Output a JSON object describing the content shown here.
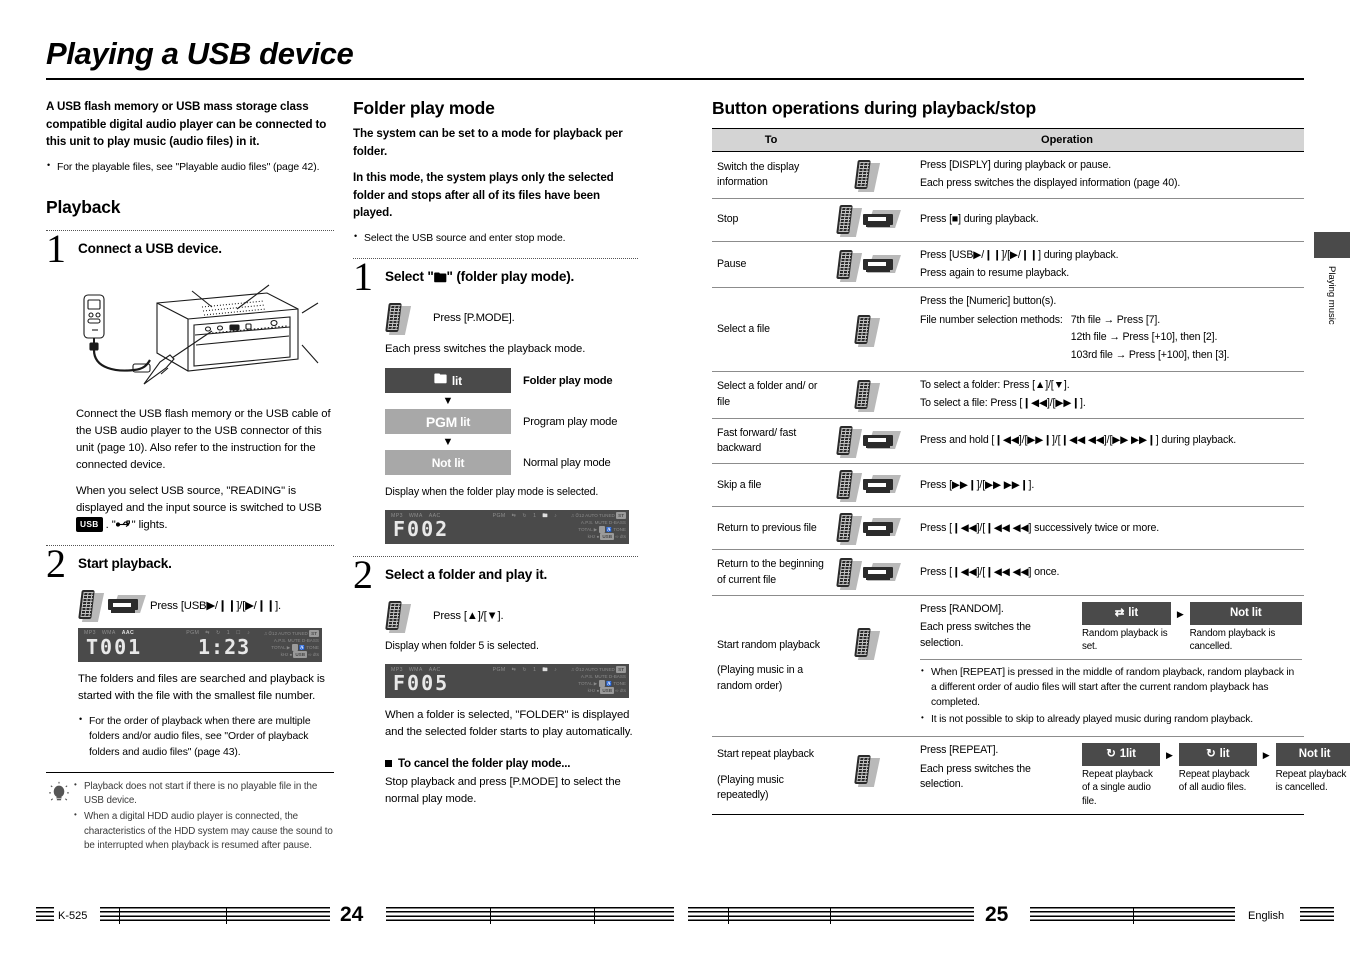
{
  "document": {
    "title": "Playing a USB device",
    "model": "K-525",
    "language": "English",
    "page_left": "24",
    "page_right": "25",
    "side_tab": "Playing music"
  },
  "intro": {
    "lead": "A USB flash memory or USB mass storage class compatible digital audio player can be connected to this unit to play music (audio files) in it.",
    "bullets": [
      "For the playable files, see \"Playable audio files\" (page 42)."
    ]
  },
  "playback": {
    "heading": "Playback",
    "step1": {
      "number": "1",
      "head": "Connect a USB device.",
      "para1": "Connect the USB flash memory or the USB cable of the USB audio player to the USB connector of this unit (page 10). Also refer to the instruction for the connected device.",
      "para2_a": "When you select USB source, \"READING\" is displayed and the input source is switched to USB",
      "usb_badge": "USB",
      "para2_b": "\" lights."
    },
    "step2": {
      "number": "2",
      "head": "Start playback.",
      "press": "Press [USB▶/❙❙]/[▶/❙❙].",
      "lcd": {
        "main": "T001",
        "time": "1:23",
        "indicators": [
          "MP3",
          "WMA",
          "AAC",
          "PGM"
        ],
        "highlight": "AAC"
      },
      "para": "The folders and files are searched and playback is started with the file with the smallest file number.",
      "bullets": [
        "For the order of playback when there are multiple folders and/or audio files, see  \"Order of playback folders and audio files\" (page 43)."
      ]
    },
    "tips": [
      "Playback does not start if there is no playable file in the USB device.",
      "When a digital HDD audio player is connected, the characteristics of the HDD system may cause the sound to be interrupted when playback is resumed after pause."
    ]
  },
  "folder_play": {
    "heading": "Folder play mode",
    "lead1": "The system can be set to a mode for playback per folder.",
    "lead2": "In this mode, the system plays only the selected folder and stops after all of its files have been played.",
    "bullets": [
      "Select the USB source and enter stop mode."
    ],
    "step1": {
      "number": "1",
      "head_a": "Select \"",
      "head_b": "\" (folder play mode).",
      "press": "Press [P.MODE].",
      "note": "Each press switches the playback mode.",
      "modes": [
        {
          "box": "lit",
          "icon": "folder",
          "label": "Folder play mode",
          "style": "dark",
          "bold": true
        },
        {
          "box": "lit",
          "icon": "pgm",
          "label": "Program play mode",
          "style": "mid",
          "bold": false
        },
        {
          "box": "Not lit",
          "icon": "",
          "label": "Normal play mode",
          "style": "mid",
          "bold": false
        }
      ],
      "caption": "Display when the folder play mode is selected.",
      "lcd": {
        "main": "F002"
      }
    },
    "step2": {
      "number": "2",
      "head": "Select a folder and play it.",
      "press": "Press [▲]/[▼].",
      "caption": "Display when folder 5 is selected.",
      "lcd": {
        "main": "F005"
      },
      "para": "When a folder is selected, \"FOLDER\" is displayed and the selected folder starts to play automatically."
    },
    "cancel": {
      "head": "To cancel the folder play mode...",
      "body": "Stop playback and press [P.MODE] to select the normal play mode."
    }
  },
  "operations": {
    "heading": "Button operations during playback/stop",
    "columns": {
      "to": "To",
      "operation": "Operation"
    },
    "rows": [
      {
        "to": "Switch the display information",
        "icons": [
          "remote"
        ],
        "lines": [
          "Press [DISPLY] during playback or pause.",
          "Each press switches the displayed information (page 40)."
        ]
      },
      {
        "to": "Stop",
        "icons": [
          "remote",
          "unit"
        ],
        "lines": [
          "Press [■] during playback."
        ]
      },
      {
        "to": "Pause",
        "icons": [
          "remote",
          "unit"
        ],
        "lines": [
          "Press [USB▶/❙❙]/[▶/❙❙] during playback.",
          "Press again to resume playback."
        ]
      },
      {
        "to": "Select a file",
        "icons": [
          "remote"
        ],
        "lines": [
          "Press the [Numeric] button(s)."
        ],
        "methods_label": "File number selection methods:",
        "methods": [
          "7th file → Press [7].",
          "12th file → Press [+10], then [2].",
          "103rd file → Press [+100], then [3]."
        ]
      },
      {
        "to": "Select a folder and/ or file",
        "icons": [
          "remote"
        ],
        "lines": [
          "To select a folder: Press [▲]/[▼].",
          "To select a file: Press [❙◀◀]/[▶▶❙]."
        ]
      },
      {
        "to": "Fast forward/ fast backward",
        "icons": [
          "remote",
          "unit"
        ],
        "lines": [
          "Press and hold [❙◀◀]/[▶▶❙]/[❙◀◀ ◀◀]/[▶▶ ▶▶❙] during playback."
        ]
      },
      {
        "to": "Skip a file",
        "icons": [
          "remote",
          "unit"
        ],
        "lines": [
          "Press [▶▶❙]/[▶▶ ▶▶❙]."
        ]
      },
      {
        "to": "Return to previous file",
        "icons": [
          "remote",
          "unit"
        ],
        "lines": [
          "Press [❙◀◀]/[❙◀◀ ◀◀] successively twice or more."
        ]
      },
      {
        "to": "Return to the beginning of current file",
        "icons": [
          "remote",
          "unit"
        ],
        "lines": [
          "Press [❙◀◀]/[❙◀◀ ◀◀] once."
        ]
      }
    ],
    "random": {
      "to": "Start random playback",
      "to_sub": "(Playing music in a random order)",
      "icons": [
        "remote"
      ],
      "lines": [
        "Press [RANDOM].",
        "Each press switches the selection."
      ],
      "states": [
        {
          "box": "lit",
          "icon": "shuffle",
          "caption": "Random playback is set."
        },
        {
          "box": "Not lit",
          "icon": "",
          "caption": "Random playback is cancelled."
        }
      ],
      "notes": [
        "When [REPEAT] is pressed in the middle of random playback, random playback in a different order of audio files will start after the current random playback has completed.",
        "It is not possible to skip to already played music during random playback."
      ]
    },
    "repeat": {
      "to": "Start repeat playback",
      "to_sub": "(Playing music repeatedly)",
      "icons": [
        "remote"
      ],
      "lines": [
        "Press [REPEAT].",
        "Each press switches the selection."
      ],
      "states": [
        {
          "box": "1lit",
          "icon": "repeat",
          "caption": "Repeat playback of a single audio file."
        },
        {
          "box": "lit",
          "icon": "repeat",
          "caption": "Repeat playback of all audio files."
        },
        {
          "box": "Not lit",
          "icon": "",
          "caption": "Repeat playback is cancelled."
        }
      ]
    }
  }
}
